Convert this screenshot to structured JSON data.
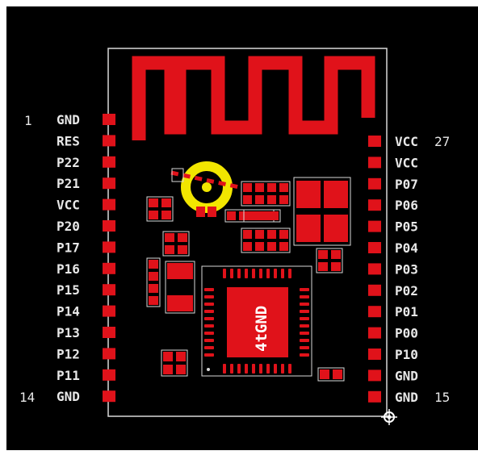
{
  "colors": {
    "background": "#000000",
    "outline": "#d9d9d9",
    "pad": "#e0121a",
    "silkscreen": "#e8e8e8",
    "antenna_ring": "#f2e600"
  },
  "left_pins": [
    "GND",
    "RES",
    "P22",
    "P21",
    "VCC",
    "P20",
    "P17",
    "P16",
    "P15",
    "P14",
    "P13",
    "P12",
    "P11",
    "GND"
  ],
  "right_pins": [
    "VCC",
    "VCC",
    "P07",
    "P06",
    "P05",
    "P04",
    "P03",
    "P02",
    "P01",
    "P00",
    "P10",
    "GND",
    "GND"
  ],
  "pin_numbers": {
    "left_top": "1",
    "left_bottom": "14",
    "right_top": "27",
    "right_bottom": "15"
  },
  "chip_label": "4tGND",
  "icons": [
    "origin-marker-icon"
  ]
}
